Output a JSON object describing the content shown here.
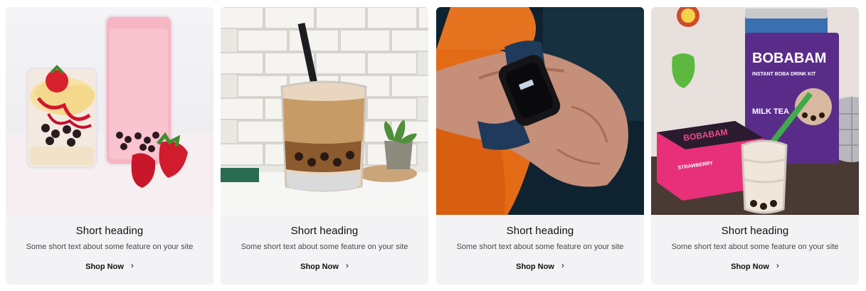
{
  "cards": [
    {
      "image": "strawberry-boba-drinks",
      "heading": "Short heading",
      "text": "Some short text about some feature on your site",
      "cta": "Shop Now",
      "cta_icon": "chevron-right-icon"
    },
    {
      "image": "iced-milk-tea-glass",
      "heading": "Short heading",
      "text": "Some short text about some feature on your site",
      "cta": "Shop Now",
      "cta_icon": "chevron-right-icon"
    },
    {
      "image": "smartwatch-on-wrist",
      "heading": "Short heading",
      "text": "Some short text about some feature on your site",
      "cta": "Shop Now",
      "cta_icon": "chevron-right-icon"
    },
    {
      "image": "bobabam-kit-box",
      "image_text": {
        "brand": "BOBABAM",
        "tagline": "INSTANT BOBA DRINK KIT",
        "flavor": "MILK TEA",
        "box_brand": "BOBABAM",
        "box_flavor": "STRAWBERRY"
      },
      "heading": "Short heading",
      "text": "Some short text about some feature on your site",
      "cta": "Shop Now",
      "cta_icon": "chevron-right-icon"
    }
  ]
}
